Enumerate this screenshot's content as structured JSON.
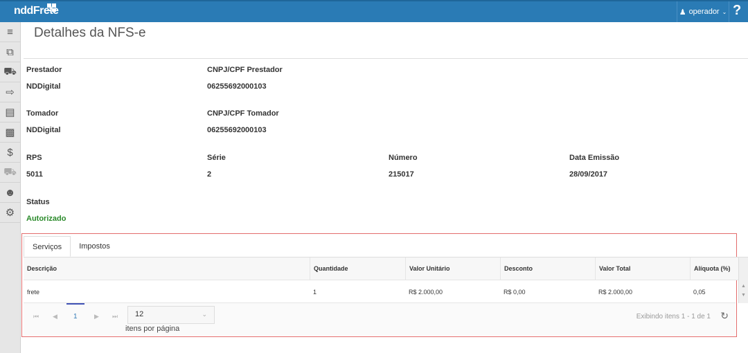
{
  "header": {
    "logo": "nddFrete",
    "user": "operador",
    "help": "?"
  },
  "sidebar": {
    "items": [
      "menu-icon",
      "documents-icon",
      "truck-icon",
      "export-icon",
      "file-icon",
      "money-icon",
      "payment-cycle-icon",
      "truck-outline-icon",
      "users-icon",
      "settings-icon"
    ]
  },
  "page": {
    "title": "Detalhes da NFS-e"
  },
  "fields": {
    "prestador": {
      "label": "Prestador",
      "value": "NDDigital"
    },
    "cnpj_prestador": {
      "label": "CNPJ/CPF Prestador",
      "value": "06255692000103"
    },
    "tomador": {
      "label": "Tomador",
      "value": "NDDigital"
    },
    "cnpj_tomador": {
      "label": "CNPJ/CPF Tomador",
      "value": "06255692000103"
    },
    "rps": {
      "label": "RPS",
      "value": "5011"
    },
    "serie": {
      "label": "Série",
      "value": "2"
    },
    "numero": {
      "label": "Número",
      "value": "215017"
    },
    "data_emissao": {
      "label": "Data Emissão",
      "value": "28/09/2017"
    },
    "status": {
      "label": "Status",
      "value": "Autorizado"
    }
  },
  "tabs": [
    "Serviços",
    "Impostos"
  ],
  "table": {
    "columns": [
      "Descrição",
      "Quantidade",
      "Valor Unitário",
      "Desconto",
      "Valor Total",
      "Alíquota (%)"
    ],
    "rows": [
      [
        "frete",
        "1",
        "R$ 2.000,00",
        "R$ 0,00",
        "R$ 2.000,00",
        "0,05"
      ]
    ]
  },
  "pager": {
    "page": "1",
    "page_size": "12",
    "page_size_label": "itens por página",
    "info": "Exibindo itens 1 - 1 de 1"
  }
}
